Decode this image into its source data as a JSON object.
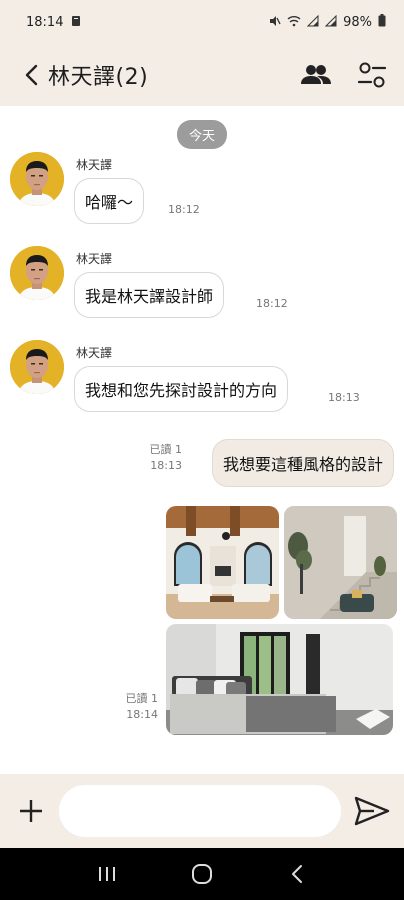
{
  "status_bar": {
    "time": "18:14",
    "battery": "98%"
  },
  "header": {
    "title": "林天譯(2)",
    "icons": [
      "back-chevron-icon",
      "members-icon",
      "settings-sliders-icon"
    ]
  },
  "chat": {
    "date_label": "今天",
    "messages_in": [
      {
        "sender": "林天譯",
        "text": "哈囉〜",
        "time": "18:12"
      },
      {
        "sender": "林天譯",
        "text": "我是林天譯設計師",
        "time": "18:12"
      },
      {
        "sender": "林天譯",
        "text": "我想和您先探討設計的方向",
        "time": "18:13"
      }
    ],
    "messages_out": [
      {
        "text": "我想要這種風格的設計",
        "read": "已讀 1",
        "time": "18:13"
      }
    ],
    "photo_message": {
      "read": "已讀 1",
      "time": "18:14"
    }
  },
  "input_bar": {
    "placeholder": "",
    "icons": [
      "plus-icon",
      "send-icon"
    ]
  },
  "nav_bar": {
    "icons": [
      "recent-apps-icon",
      "home-icon",
      "back-icon"
    ]
  },
  "colors": {
    "header_bg": "#f3ede6",
    "bubble_out_bg": "#f1ebe4",
    "date_pill_bg": "#9c9c9c"
  }
}
